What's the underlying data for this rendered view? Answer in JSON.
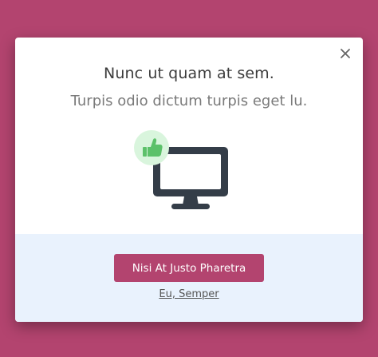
{
  "dialog": {
    "title": "Nunc ut quam at sem.",
    "subtitle": "Turpis odio dictum turpis eget lu.",
    "primary_button_label": "Nisi At Justo Pharetra",
    "secondary_link_label": "Eu, Semper"
  },
  "icons": {
    "close": "close-icon",
    "illustration": "monitor-icon",
    "badge": "thumbs-up-icon"
  },
  "colors": {
    "backdrop": "#b3446f",
    "primary": "#b3446f",
    "footer_bg": "#e9f2fd",
    "monitor": "#343d48",
    "badge_bg": "#d9f5dd",
    "thumb": "#5cc16a"
  }
}
